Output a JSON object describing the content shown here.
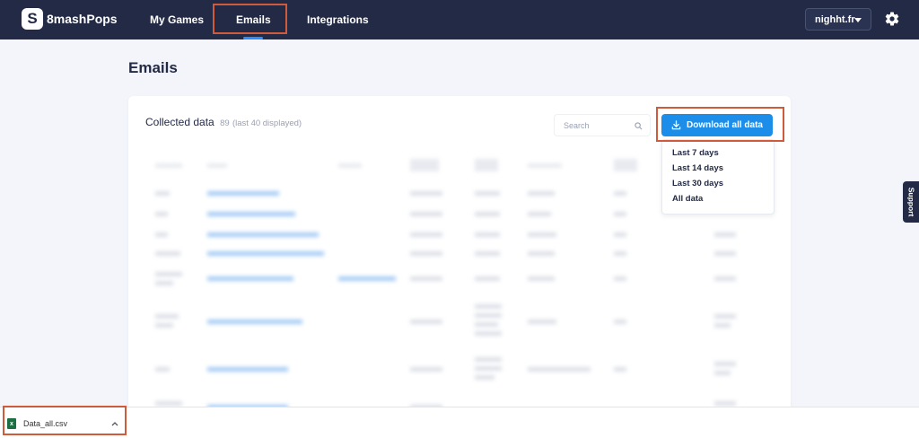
{
  "nav": {
    "logo_mark": "S",
    "logo_text": "8mashPops",
    "items": [
      {
        "label": "My Games"
      },
      {
        "label": "Emails"
      },
      {
        "label": "Integrations"
      }
    ],
    "active": "Emails",
    "site": "nighht.fr"
  },
  "page": {
    "title": "Emails"
  },
  "collected": {
    "title": "Collected data",
    "count": "89",
    "note": "(last 40 displayed)",
    "search_placeholder": "Search"
  },
  "download": {
    "label": "Download all data",
    "options": [
      "Last 7 days",
      "Last 14 days",
      "Last 30 days",
      "All data"
    ]
  },
  "support": "Support",
  "downloads_bar": {
    "file": "Data_all.csv"
  },
  "colors": {
    "accent": "#1c8eea",
    "nav_bg": "#232a45",
    "highlight": "#cf5a3c"
  }
}
